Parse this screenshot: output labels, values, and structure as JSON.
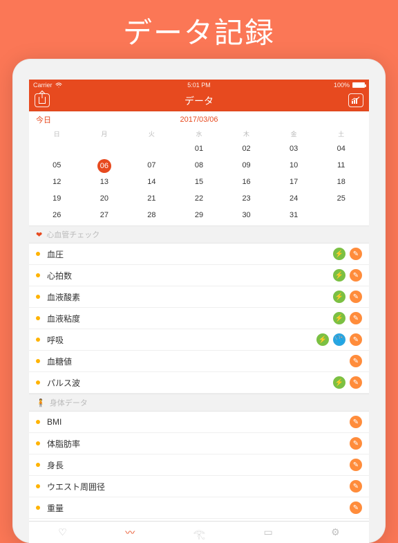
{
  "promo_title": "データ記録",
  "status": {
    "carrier": "Carrier",
    "time": "5:01 PM",
    "battery": "100%"
  },
  "nav": {
    "title": "データ"
  },
  "subbar": {
    "today": "今日",
    "date": "2017/03/06"
  },
  "calendar": {
    "weekdays": [
      "日",
      "月",
      "火",
      "水",
      "木",
      "金",
      "土"
    ],
    "rows": [
      [
        "",
        "",
        "",
        "01",
        "02",
        "03",
        "04"
      ],
      [
        "05",
        "06",
        "07",
        "08",
        "09",
        "10",
        "11"
      ],
      [
        "12",
        "13",
        "14",
        "15",
        "16",
        "17",
        "18"
      ],
      [
        "19",
        "20",
        "21",
        "22",
        "23",
        "24",
        "25"
      ],
      [
        "26",
        "27",
        "28",
        "29",
        "30",
        "31",
        ""
      ]
    ],
    "selected": "06"
  },
  "sections": [
    {
      "icon": "heart",
      "title": "心血管チェック",
      "items": [
        {
          "label": "血圧",
          "actions": [
            "measure",
            "edit"
          ]
        },
        {
          "label": "心拍数",
          "actions": [
            "measure",
            "edit"
          ]
        },
        {
          "label": "血液酸素",
          "actions": [
            "measure",
            "edit"
          ]
        },
        {
          "label": "血液粘度",
          "actions": [
            "measure",
            "edit"
          ]
        },
        {
          "label": "呼吸",
          "actions": [
            "measure",
            "steth",
            "edit"
          ]
        },
        {
          "label": "血糖値",
          "actions": [
            "edit"
          ]
        },
        {
          "label": "パルス波",
          "actions": [
            "measure",
            "edit"
          ]
        }
      ]
    },
    {
      "icon": "person",
      "title": "身体データ",
      "items": [
        {
          "label": "BMI",
          "actions": [
            "edit"
          ]
        },
        {
          "label": "体脂肪率",
          "actions": [
            "edit"
          ]
        },
        {
          "label": "身長",
          "actions": [
            "edit"
          ]
        },
        {
          "label": "ウエスト周囲径",
          "actions": [
            "edit"
          ]
        },
        {
          "label": "重量",
          "actions": [
            "edit"
          ]
        }
      ]
    }
  ],
  "action_colors": {
    "measure": "green",
    "edit": "orange",
    "steth": "blue"
  },
  "action_glyphs": {
    "measure": "⚡",
    "edit": "✎",
    "steth": "🩺"
  },
  "tabs": [
    {
      "name": "heart",
      "glyph": "♡"
    },
    {
      "name": "activity",
      "glyph": "〰"
    },
    {
      "name": "run",
      "glyph": "𓂀"
    },
    {
      "name": "doc",
      "glyph": "▭"
    },
    {
      "name": "gear",
      "glyph": "⚙"
    }
  ],
  "tab_active": "activity"
}
